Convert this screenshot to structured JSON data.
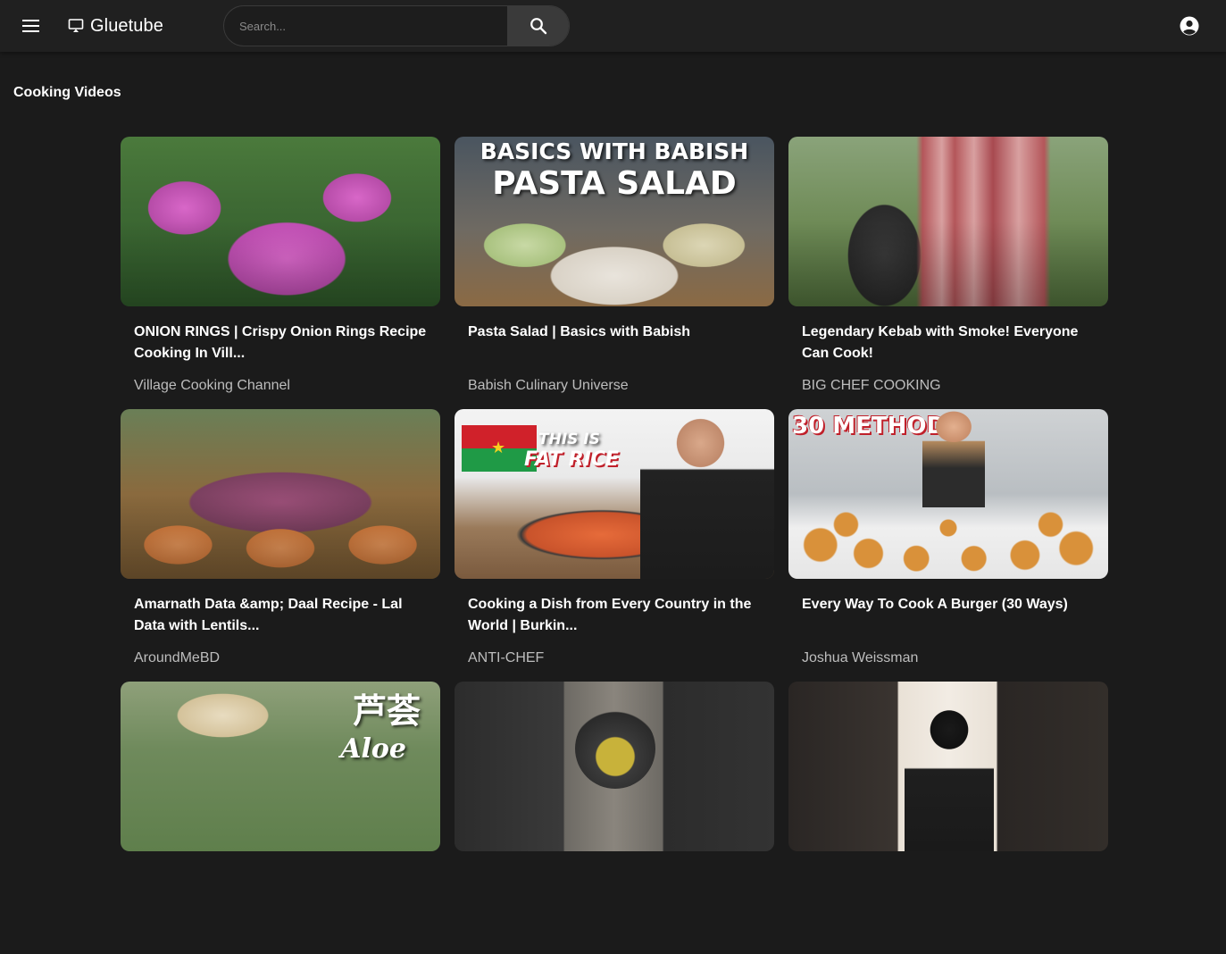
{
  "app": {
    "name": "Gluetube"
  },
  "search": {
    "placeholder": "Search..."
  },
  "section": {
    "title": "Cooking Videos"
  },
  "videos": [
    {
      "title": "ONION RINGS | Crispy Onion Rings Recipe Cooking In Vill...",
      "channel": "Village Cooking Channel"
    },
    {
      "title": "Pasta Salad | Basics with Babish",
      "channel": "Babish Culinary Universe",
      "thumb_text_1": "BASICS WITH BABISH",
      "thumb_text_2": "PASTA SALAD"
    },
    {
      "title": "Legendary Kebab with Smoke! Everyone Can Cook!",
      "channel": "BIG CHEF COOKING"
    },
    {
      "title": "Amarnath Data &amp; Daal Recipe - Lal Data with Lentils...",
      "channel": "AroundMeBD"
    },
    {
      "title": "Cooking a Dish from Every Country in the World | Burkin...",
      "channel": "ANTI-CHEF",
      "thumb_text_1": "THIS IS",
      "thumb_text_2": "FAT RICE"
    },
    {
      "title": "Every Way To Cook A Burger (30 Ways)",
      "channel": "Joshua Weissman",
      "thumb_text_1": "30 METHODS"
    },
    {
      "title": "",
      "channel": "",
      "thumb_text_1": "芦荟",
      "thumb_text_2": "Aloe"
    },
    {
      "title": "",
      "channel": ""
    },
    {
      "title": "",
      "channel": ""
    }
  ],
  "colors": {
    "background": "#1b1b1b",
    "topbar": "#202020",
    "search_button": "#3a3a3a",
    "channel_text": "#bdbdbd"
  }
}
